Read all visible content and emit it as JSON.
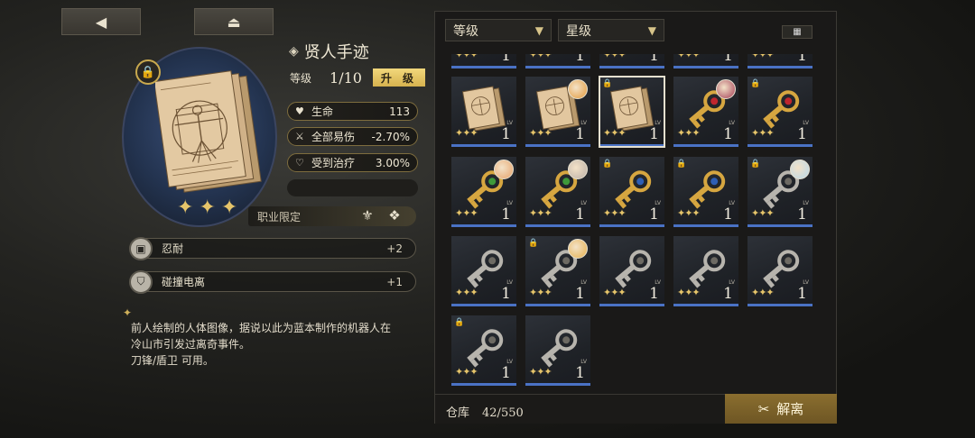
{
  "topbar": {
    "back_icon": "◀",
    "home_icon": "⏏"
  },
  "item": {
    "title": "贤人手迹",
    "level_label": "等级",
    "level_value": "1/10",
    "upgrade_label": "升 级",
    "stars": 3,
    "stats": [
      {
        "icon": "heart-icon",
        "glyph": "♥",
        "name": "生命",
        "value": "113"
      },
      {
        "icon": "sword-icon",
        "glyph": "⚔",
        "name": "全部易伤",
        "value": "-2.70%"
      },
      {
        "icon": "heal-icon",
        "glyph": "♡",
        "name": "受到治疗",
        "value": "3.00%"
      }
    ],
    "job_limit_label": "职业限定",
    "skills": [
      {
        "name": "忍耐",
        "value": "+2"
      },
      {
        "name": "碰撞电离",
        "value": "+1"
      }
    ],
    "description": [
      "前人绘制的人体图像，据说以此为蓝本制作的机器人在",
      "冷山市引发过离奇事件。",
      "刀锋/盾卫 可用。"
    ]
  },
  "filters": {
    "level": "等级",
    "stars": "星级"
  },
  "inventory": {
    "partial_top_row_count": 5,
    "level_text": "1",
    "lv_text": "LV",
    "items": [
      {
        "kind": "paper",
        "locked": false,
        "avatar": false,
        "selected": false
      },
      {
        "kind": "paper",
        "locked": false,
        "avatar": true,
        "avatar_color": "#e39a3b",
        "selected": false
      },
      {
        "kind": "paper",
        "locked": true,
        "avatar": false,
        "selected": true
      },
      {
        "kind": "key-red",
        "locked": false,
        "avatar": true,
        "avatar_color": "#a33d55",
        "selected": false
      },
      {
        "kind": "key-red",
        "locked": true,
        "avatar": false,
        "selected": false
      },
      {
        "kind": "key-green",
        "locked": false,
        "avatar": true,
        "avatar_color": "#e7a36a",
        "selected": false
      },
      {
        "kind": "key-green",
        "locked": false,
        "avatar": true,
        "avatar_color": "#bcb1a8",
        "selected": false
      },
      {
        "kind": "key-blue",
        "locked": true,
        "avatar": false,
        "selected": false
      },
      {
        "kind": "key-blue",
        "locked": true,
        "avatar": false,
        "selected": false
      },
      {
        "kind": "key-silver",
        "locked": true,
        "avatar": true,
        "avatar_color": "#b8d8ea",
        "selected": false
      },
      {
        "kind": "key-silver",
        "locked": false,
        "avatar": false,
        "selected": false
      },
      {
        "kind": "key-silver",
        "locked": true,
        "avatar": true,
        "avatar_color": "#e6b04d",
        "selected": false
      },
      {
        "kind": "key-silver",
        "locked": false,
        "avatar": false,
        "selected": false
      },
      {
        "kind": "key-silver",
        "locked": false,
        "avatar": false,
        "selected": false
      },
      {
        "kind": "key-silver",
        "locked": false,
        "avatar": false,
        "selected": false
      },
      {
        "kind": "key-silver",
        "locked": true,
        "avatar": false,
        "selected": false
      },
      {
        "kind": "key-silver",
        "locked": false,
        "avatar": false,
        "selected": false
      }
    ]
  },
  "footer": {
    "storage_label": "仓库",
    "storage_value": "42/550",
    "dismantle_label": "解离"
  },
  "colors": {
    "accent_gold": "#e5c46a",
    "rarity_blue": "#4a72c5"
  }
}
